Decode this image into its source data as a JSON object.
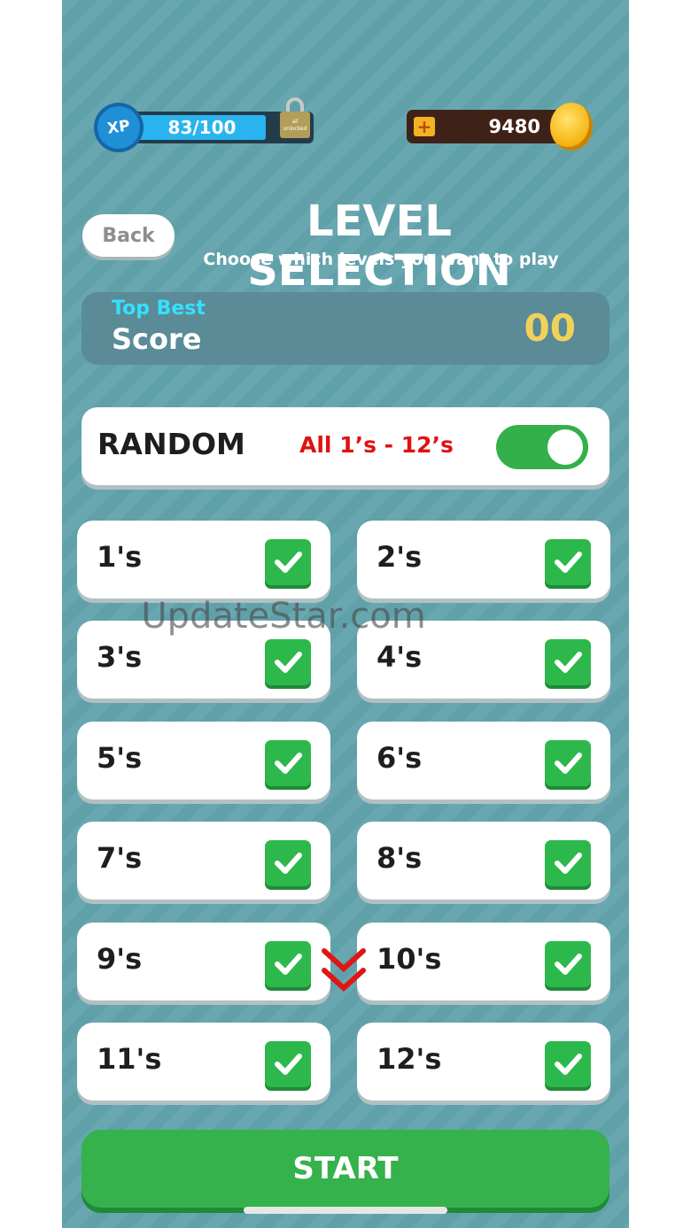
{
  "xp": {
    "badge": "XP",
    "text": "83/100",
    "progress": 0.83,
    "lock_text": "all unlocked"
  },
  "coins": {
    "plus": "+",
    "value": "9480"
  },
  "header": {
    "back": "Back",
    "title": "LEVEL SELECTION",
    "subtitle": "Choose which levels you want to play"
  },
  "score": {
    "label_top": "Top Best",
    "label": "Score",
    "value": "00"
  },
  "random": {
    "title": "RANDOM",
    "desc": "All 1’s - 12’s",
    "enabled": true
  },
  "levels": [
    {
      "label": "1's",
      "checked": true
    },
    {
      "label": "2's",
      "checked": true
    },
    {
      "label": "3's",
      "checked": true
    },
    {
      "label": "4's",
      "checked": true
    },
    {
      "label": "5's",
      "checked": true
    },
    {
      "label": "6's",
      "checked": true
    },
    {
      "label": "7's",
      "checked": true
    },
    {
      "label": "8's",
      "checked": true
    },
    {
      "label": "9's",
      "checked": true
    },
    {
      "label": "10's",
      "checked": true
    },
    {
      "label": "11's",
      "checked": true
    },
    {
      "label": "12's",
      "checked": true
    }
  ],
  "start": "START",
  "watermark": "UpdateStar.com",
  "colors": {
    "background": "#62a4ad",
    "green": "#35b24c",
    "accent_red": "#e11111",
    "score_gold": "#f0d25a"
  }
}
